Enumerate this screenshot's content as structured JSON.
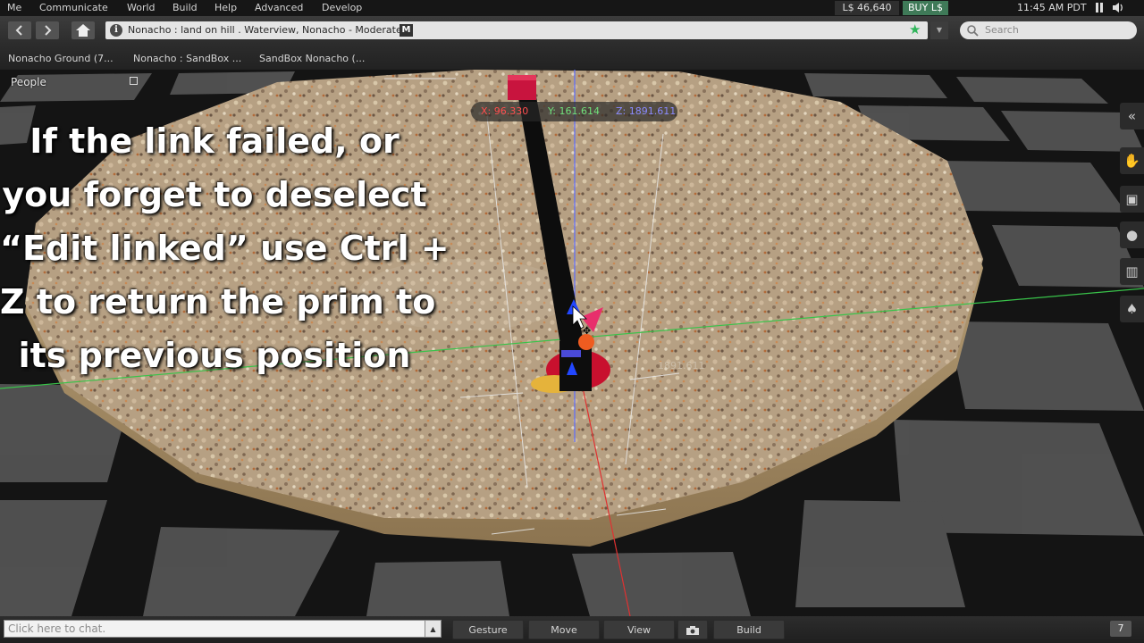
{
  "menu": {
    "items": [
      "Me",
      "Communicate",
      "World",
      "Build",
      "Help",
      "Advanced",
      "Develop"
    ],
    "balance": "L$ 46,640",
    "buy_label": "BUY L$",
    "clock": "11:45 AM PDT"
  },
  "nav": {
    "location": "Nonacho : land on hill . Waterview, Nonacho - Moderate",
    "maturity_badge": "M",
    "search_placeholder": "Search"
  },
  "favorites": [
    "Nonacho Ground (7...",
    "Nonacho : SandBox ...",
    "SandBox Nonacho (..."
  ],
  "people_panel": {
    "title": "People"
  },
  "overlay": {
    "lines": [
      "If the link failed, or",
      "you forget to deselect",
      "“Edit linked” use Ctrl +",
      "Z to return the prim to",
      "its previous position"
    ]
  },
  "coords": {
    "x": "X: 96.330",
    "y": "Y: 161.614",
    "z": "Z: 1891.611"
  },
  "scene": {
    "floor_label": "1891.611"
  },
  "bottom": {
    "chat_placeholder": "Click here to chat.",
    "gesture": "Gesture",
    "move": "Move",
    "view": "View",
    "build": "Build",
    "notifications": "7"
  }
}
